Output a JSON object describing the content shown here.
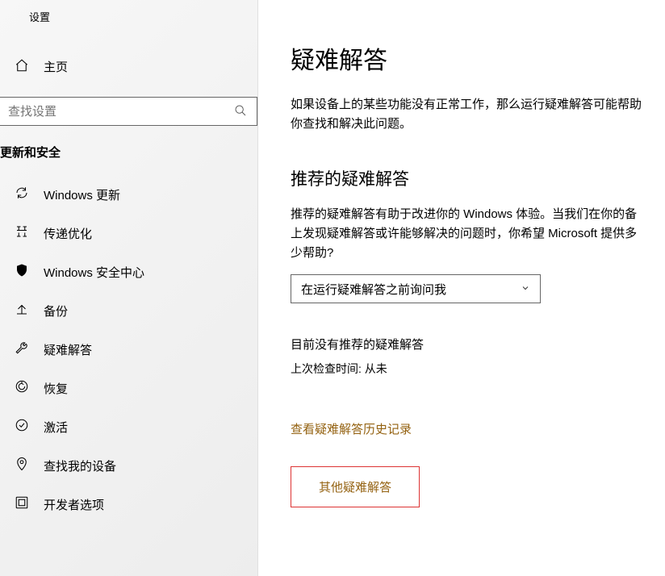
{
  "header": {
    "settings": "设置"
  },
  "home": {
    "label": "主页"
  },
  "search": {
    "placeholder": "查找设置"
  },
  "category": "更新和安全",
  "nav": [
    {
      "label": "Windows 更新",
      "icon": "refresh-icon"
    },
    {
      "label": "传递优化",
      "icon": "delivery-icon"
    },
    {
      "label": "Windows 安全中心",
      "icon": "shield-icon"
    },
    {
      "label": "备份",
      "icon": "backup-icon"
    },
    {
      "label": "疑难解答",
      "icon": "troubleshoot-icon"
    },
    {
      "label": "恢复",
      "icon": "recovery-icon"
    },
    {
      "label": "激活",
      "icon": "activation-icon"
    },
    {
      "label": "查找我的设备",
      "icon": "find-device-icon"
    },
    {
      "label": "开发者选项",
      "icon": "developer-icon"
    }
  ],
  "main": {
    "title": "疑难解答",
    "intro": "如果设备上的某些功能没有正常工作，那么运行疑难解答可能帮助你查找和解决此问题。",
    "section_title": "推荐的疑难解答",
    "section_body": "推荐的疑难解答有助于改进你的 Windows 体验。当我们在你的备上发现疑难解答或许能够解决的问题时，你希望 Microsoft 提供多少帮助?",
    "dropdown_value": "在运行疑难解答之前询问我",
    "status_none": "目前没有推荐的疑难解答",
    "last_check": "上次检查时间: 从未",
    "history_link": "查看疑难解答历史记录",
    "other_link": "其他疑难解答"
  }
}
